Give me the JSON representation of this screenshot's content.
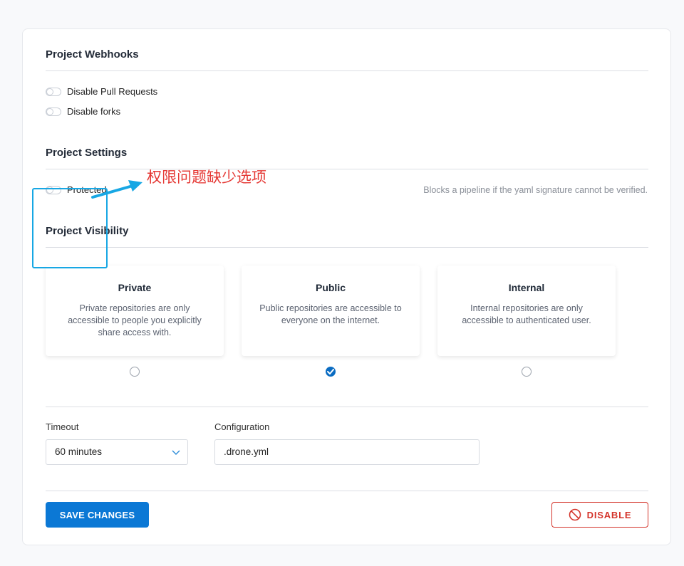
{
  "webhooks": {
    "title": "Project Webhooks",
    "toggles": [
      "Disable Pull Requests",
      "Disable forks"
    ]
  },
  "settings": {
    "title": "Project Settings",
    "protected_label": "Protected",
    "protected_hint": "Blocks a pipeline if the yaml signature cannot be verified."
  },
  "visibility": {
    "title": "Project Visibility",
    "options": [
      {
        "title": "Private",
        "desc": "Private repositories are only accessible to people you explicitly share access with.",
        "selected": false
      },
      {
        "title": "Public",
        "desc": "Public repositories are accessible to everyone on the internet.",
        "selected": true
      },
      {
        "title": "Internal",
        "desc": "Internal repositories are only accessible to authenticated user.",
        "selected": false
      }
    ]
  },
  "fields": {
    "timeout_label": "Timeout",
    "timeout_value": "60 minutes",
    "config_label": "Configuration",
    "config_value": ".drone.yml"
  },
  "actions": {
    "save": "SAVE CHANGES",
    "disable": "DISABLE"
  },
  "annotation": {
    "text": "权限问题缺少选项"
  },
  "colors": {
    "primary": "#0b78d5",
    "danger": "#d4342b",
    "annotation_box": "#17a7e4",
    "annotation_text": "#e53935"
  },
  "icons": {
    "select_arrow": "chevron-down-icon",
    "disable": "ban-icon",
    "selected_radio": "checkmark-icon"
  }
}
